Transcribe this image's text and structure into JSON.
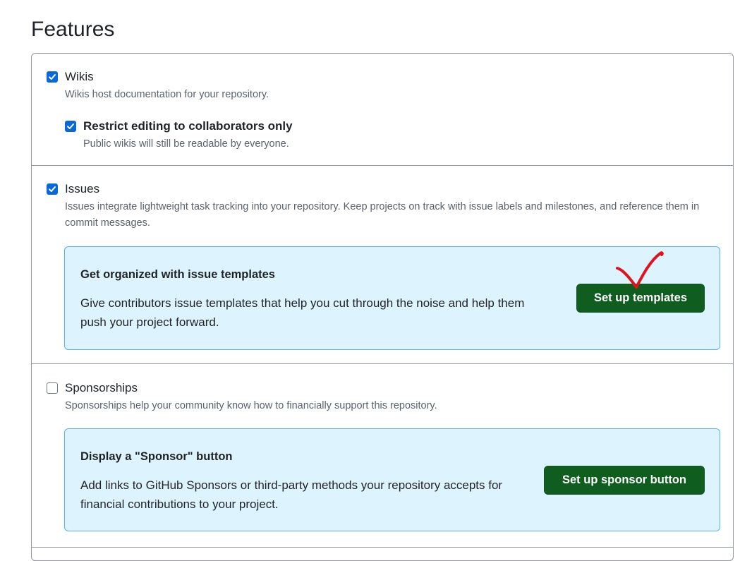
{
  "page": {
    "title": "Features"
  },
  "wikis": {
    "label": "Wikis",
    "checked": true,
    "description": "Wikis host documentation for your repository.",
    "restrict": {
      "label": "Restrict editing to collaborators only",
      "checked": true,
      "description": "Public wikis will still be readable by everyone."
    }
  },
  "issues": {
    "label": "Issues",
    "checked": true,
    "description": "Issues integrate lightweight task tracking into your repository. Keep projects on track with issue labels and milestones, and reference them in commit messages.",
    "callout": {
      "title": "Get organized with issue templates",
      "text": "Give contributors issue templates that help you cut through the noise and help them push your project forward.",
      "button_label": "Set up templates"
    }
  },
  "sponsorships": {
    "label": "Sponsorships",
    "checked": false,
    "description": "Sponsorships help your community know how to financially support this repository.",
    "callout": {
      "title": "Display a \"Sponsor\" button",
      "text": "Add links to GitHub Sponsors or third-party methods your repository accepts for financial contributions to your project.",
      "button_label": "Set up sponsor button"
    }
  },
  "colors": {
    "checkbox_checked": "#0969da",
    "callout_bg": "#ddf4ff",
    "callout_border": "#54aeff",
    "primary_button": "#0f5e1f",
    "annotation_mark": "#e0121b"
  },
  "icons": {
    "checkmark": "checkmark-icon",
    "annotation": "red-checkmark-annotation"
  }
}
